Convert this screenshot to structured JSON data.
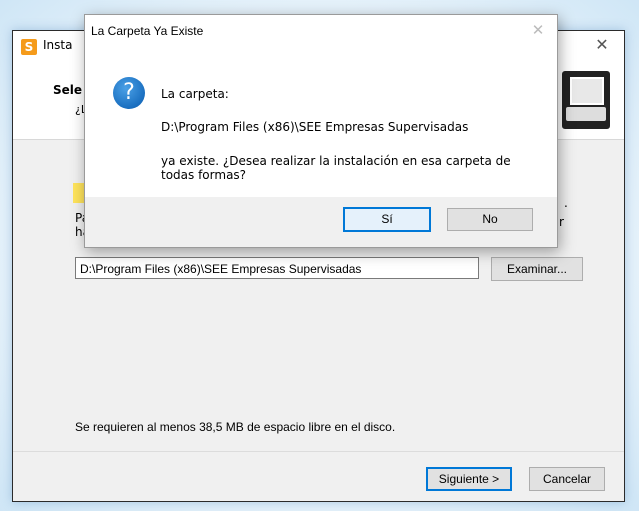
{
  "installer": {
    "title": "Insta",
    "header_title": "Sele",
    "header_subtitle": "¿L",
    "body_line1": "Pa",
    "body_line2": "ha",
    "body_right_fragment": "r",
    "body_dot": ".",
    "path_value": "D:\\Program Files (x86)\\SEE Empresas Supervisadas",
    "browse_label": "Examinar...",
    "space_text": "Se requieren al menos 38,5 MB de espacio libre en el disco.",
    "next_label": "Siguiente >",
    "cancel_label": "Cancelar"
  },
  "dialog": {
    "title": "La Carpeta Ya Existe",
    "icon": "question-icon",
    "line1": "La carpeta:",
    "line2": "D:\\Program Files (x86)\\SEE Empresas Supervisadas",
    "line3": "ya existe. ¿Desea realizar la instalación en esa carpeta de todas formas?",
    "yes_label": "Sí",
    "no_label": "No"
  }
}
